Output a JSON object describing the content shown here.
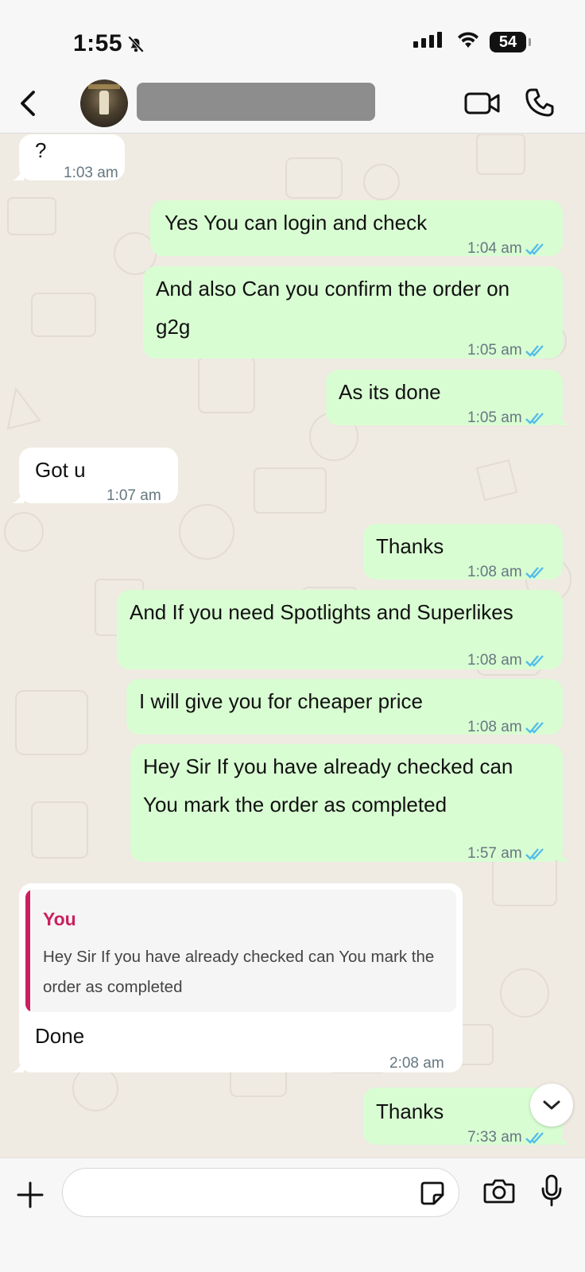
{
  "status_bar": {
    "time": "1:55",
    "battery": "54"
  },
  "header": {
    "contact_name_redacted": true
  },
  "messages": [
    {
      "dir": "in",
      "text": "?",
      "time": "1:03 am"
    },
    {
      "dir": "out",
      "text": "Yes You can login and check",
      "time": "1:04 am"
    },
    {
      "dir": "out",
      "line1": "And also Can you confirm the order on",
      "line2": "g2g",
      "time": "1:05 am"
    },
    {
      "dir": "out",
      "text": "As its done",
      "time": "1:05 am"
    },
    {
      "dir": "in",
      "text": "Got u",
      "time": "1:07 am"
    },
    {
      "dir": "out",
      "text": "Thanks",
      "time": "1:08 am"
    },
    {
      "dir": "out",
      "text": "And If you need Spotlights and Superlikes",
      "time": "1:08 am"
    },
    {
      "dir": "out",
      "text": "I will give you for cheaper price",
      "time": "1:08 am"
    },
    {
      "dir": "out",
      "line1": "Hey Sir If you have already checked can",
      "line2": "You mark the order as completed",
      "time": "1:57 am"
    },
    {
      "dir": "in",
      "reply_author": "You",
      "reply_text": "Hey Sir If you have already checked can You mark the order as completed",
      "text": "Done",
      "time": "2:08 am"
    },
    {
      "dir": "out",
      "text": "Thanks",
      "time": "7:33 am"
    }
  ],
  "composer": {
    "placeholder": ""
  },
  "colors": {
    "outgoing": "#d9fdd3",
    "incoming": "#ffffff",
    "read_tick": "#53bdeb",
    "reply_accent": "#c9215f"
  }
}
